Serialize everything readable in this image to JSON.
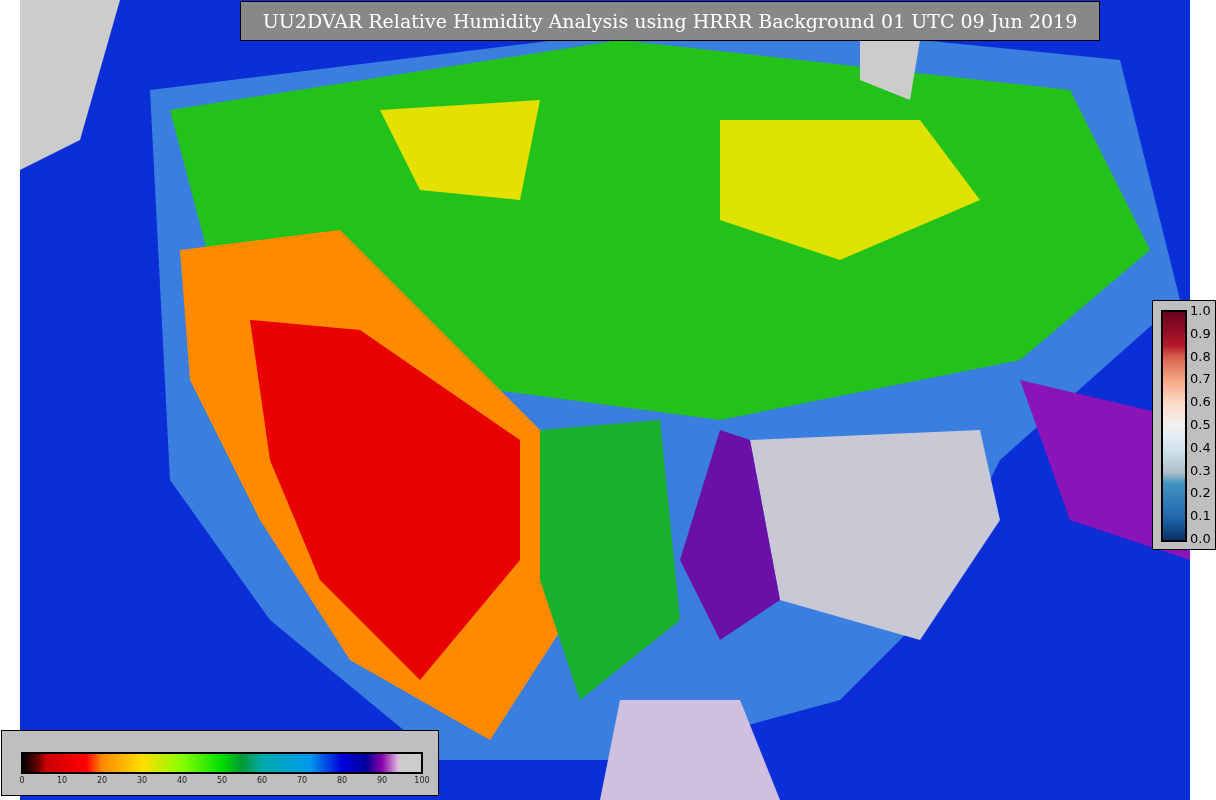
{
  "title": "UU2DVAR Relative Humidity Analysis using HRRR Background 01 UTC 09 Jun 2019",
  "bottom_colorbar": {
    "ticks": [
      "0",
      "10",
      "20",
      "30",
      "40",
      "50",
      "60",
      "70",
      "80",
      "90",
      "100"
    ]
  },
  "side_colorbar": {
    "ticks": [
      "1.0",
      "0.9",
      "0.8",
      "0.7",
      "0.6",
      "0.5",
      "0.4",
      "0.3",
      "0.2",
      "0.1",
      "0.0"
    ]
  }
}
